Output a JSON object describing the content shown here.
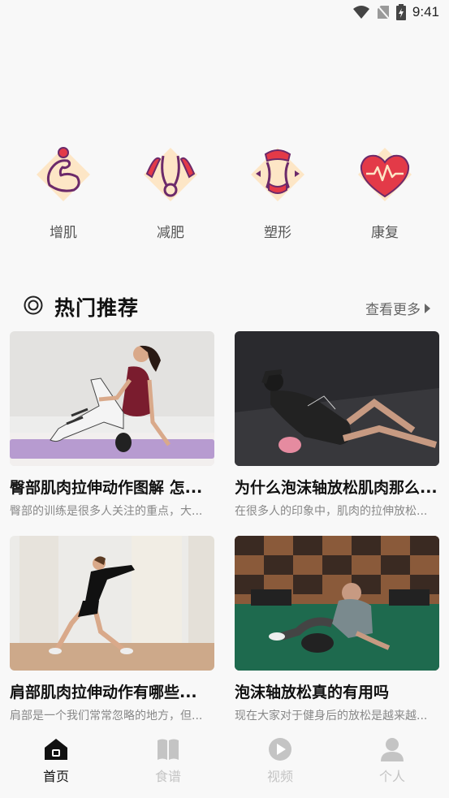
{
  "status_bar": {
    "time": "9:41"
  },
  "categories": [
    {
      "label": "增肌",
      "icon": "muscle-arm-icon"
    },
    {
      "label": "减肥",
      "icon": "slim-waist-icon"
    },
    {
      "label": "塑形",
      "icon": "body-shape-icon"
    },
    {
      "label": "康复",
      "icon": "heart-pulse-icon"
    }
  ],
  "section": {
    "title": "热门推荐",
    "more": "查看更多"
  },
  "cards": [
    {
      "title": "臀部肌肉拉伸动作图解 怎...",
      "desc": "臀部的训练是很多人关注的重点，大..."
    },
    {
      "title": "为什么泡沫轴放松肌肉那么...",
      "desc": "在很多人的印象中，肌肉的拉伸放松..."
    },
    {
      "title": "肩部肌肉拉伸动作有哪些...",
      "desc": "肩部是一个我们常常忽略的地方，但..."
    },
    {
      "title": "泡沫轴放松真的有用吗",
      "desc": "现在大家对于健身后的放松是越来越..."
    }
  ],
  "tabs": [
    {
      "label": "首页",
      "icon": "home-icon",
      "active": true
    },
    {
      "label": "食谱",
      "icon": "book-icon",
      "active": false
    },
    {
      "label": "视频",
      "icon": "video-play-icon",
      "active": false
    },
    {
      "label": "个人",
      "icon": "person-icon",
      "active": false
    }
  ],
  "colors": {
    "accent": "#e33a48",
    "icon_bg": "#fde6c6",
    "muted": "#c4c4c4"
  }
}
